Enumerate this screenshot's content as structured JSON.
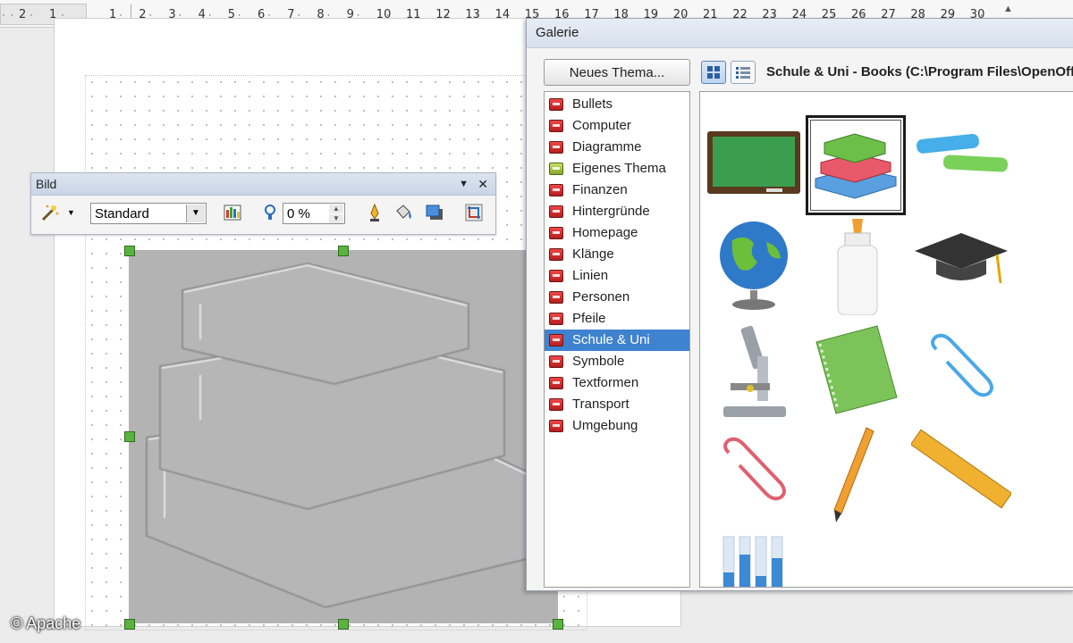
{
  "ruler": {
    "left_labels": [
      "2",
      "1"
    ],
    "labels": [
      "1",
      "2",
      "3",
      "4",
      "5",
      "6",
      "7",
      "8",
      "9",
      "10",
      "11",
      "12",
      "13",
      "14",
      "15",
      "16",
      "17",
      "18",
      "19",
      "20",
      "21",
      "22",
      "23",
      "24",
      "25",
      "26",
      "27",
      "28",
      "29",
      "30"
    ]
  },
  "bild_toolbar": {
    "title": "Bild",
    "filter_icon": "magic-wand-icon",
    "graphics_mode": "Standard",
    "color_icon": "color-bars-icon",
    "transparency_icon": "transparency-icon",
    "transparency_value": "0 %",
    "line_icon": "pen-icon",
    "area_icon": "paint-bucket-icon",
    "shadow_icon": "shadow-icon",
    "crop_icon": "crop-icon",
    "menu_glyph": "▼",
    "close_glyph": "✕"
  },
  "gallery": {
    "title": "Galerie",
    "new_theme_button": "Neues Thema...",
    "header": "Schule & Uni - Books (C:\\Program Files\\OpenOffice",
    "themes": [
      {
        "label": "Bullets",
        "icon": "theme-red-icon"
      },
      {
        "label": "Computer",
        "icon": "theme-red-icon"
      },
      {
        "label": "Diagramme",
        "icon": "theme-red-icon"
      },
      {
        "label": "Eigenes Thema",
        "icon": "theme-green-icon"
      },
      {
        "label": "Finanzen",
        "icon": "theme-red-icon"
      },
      {
        "label": "Hintergründe",
        "icon": "theme-red-icon"
      },
      {
        "label": "Homepage",
        "icon": "theme-red-icon"
      },
      {
        "label": "Klänge",
        "icon": "theme-red-icon"
      },
      {
        "label": "Linien",
        "icon": "theme-red-icon"
      },
      {
        "label": "Personen",
        "icon": "theme-red-icon"
      },
      {
        "label": "Pfeile",
        "icon": "theme-red-icon"
      },
      {
        "label": "Schule & Uni",
        "icon": "theme-red-icon",
        "selected": true
      },
      {
        "label": "Symbole",
        "icon": "theme-red-icon"
      },
      {
        "label": "Textformen",
        "icon": "theme-red-icon"
      },
      {
        "label": "Transport",
        "icon": "theme-red-icon"
      },
      {
        "label": "Umgebung",
        "icon": "theme-red-icon"
      }
    ],
    "items": [
      "chalkboard",
      "books",
      "chalk",
      "globe",
      "glue",
      "graduation-cap",
      "microscope",
      "notebook",
      "paperclip-blue",
      "paperclip-red",
      "pencil",
      "ruler",
      "test-tubes"
    ],
    "selected_item": "books"
  },
  "credit": "© Apache"
}
